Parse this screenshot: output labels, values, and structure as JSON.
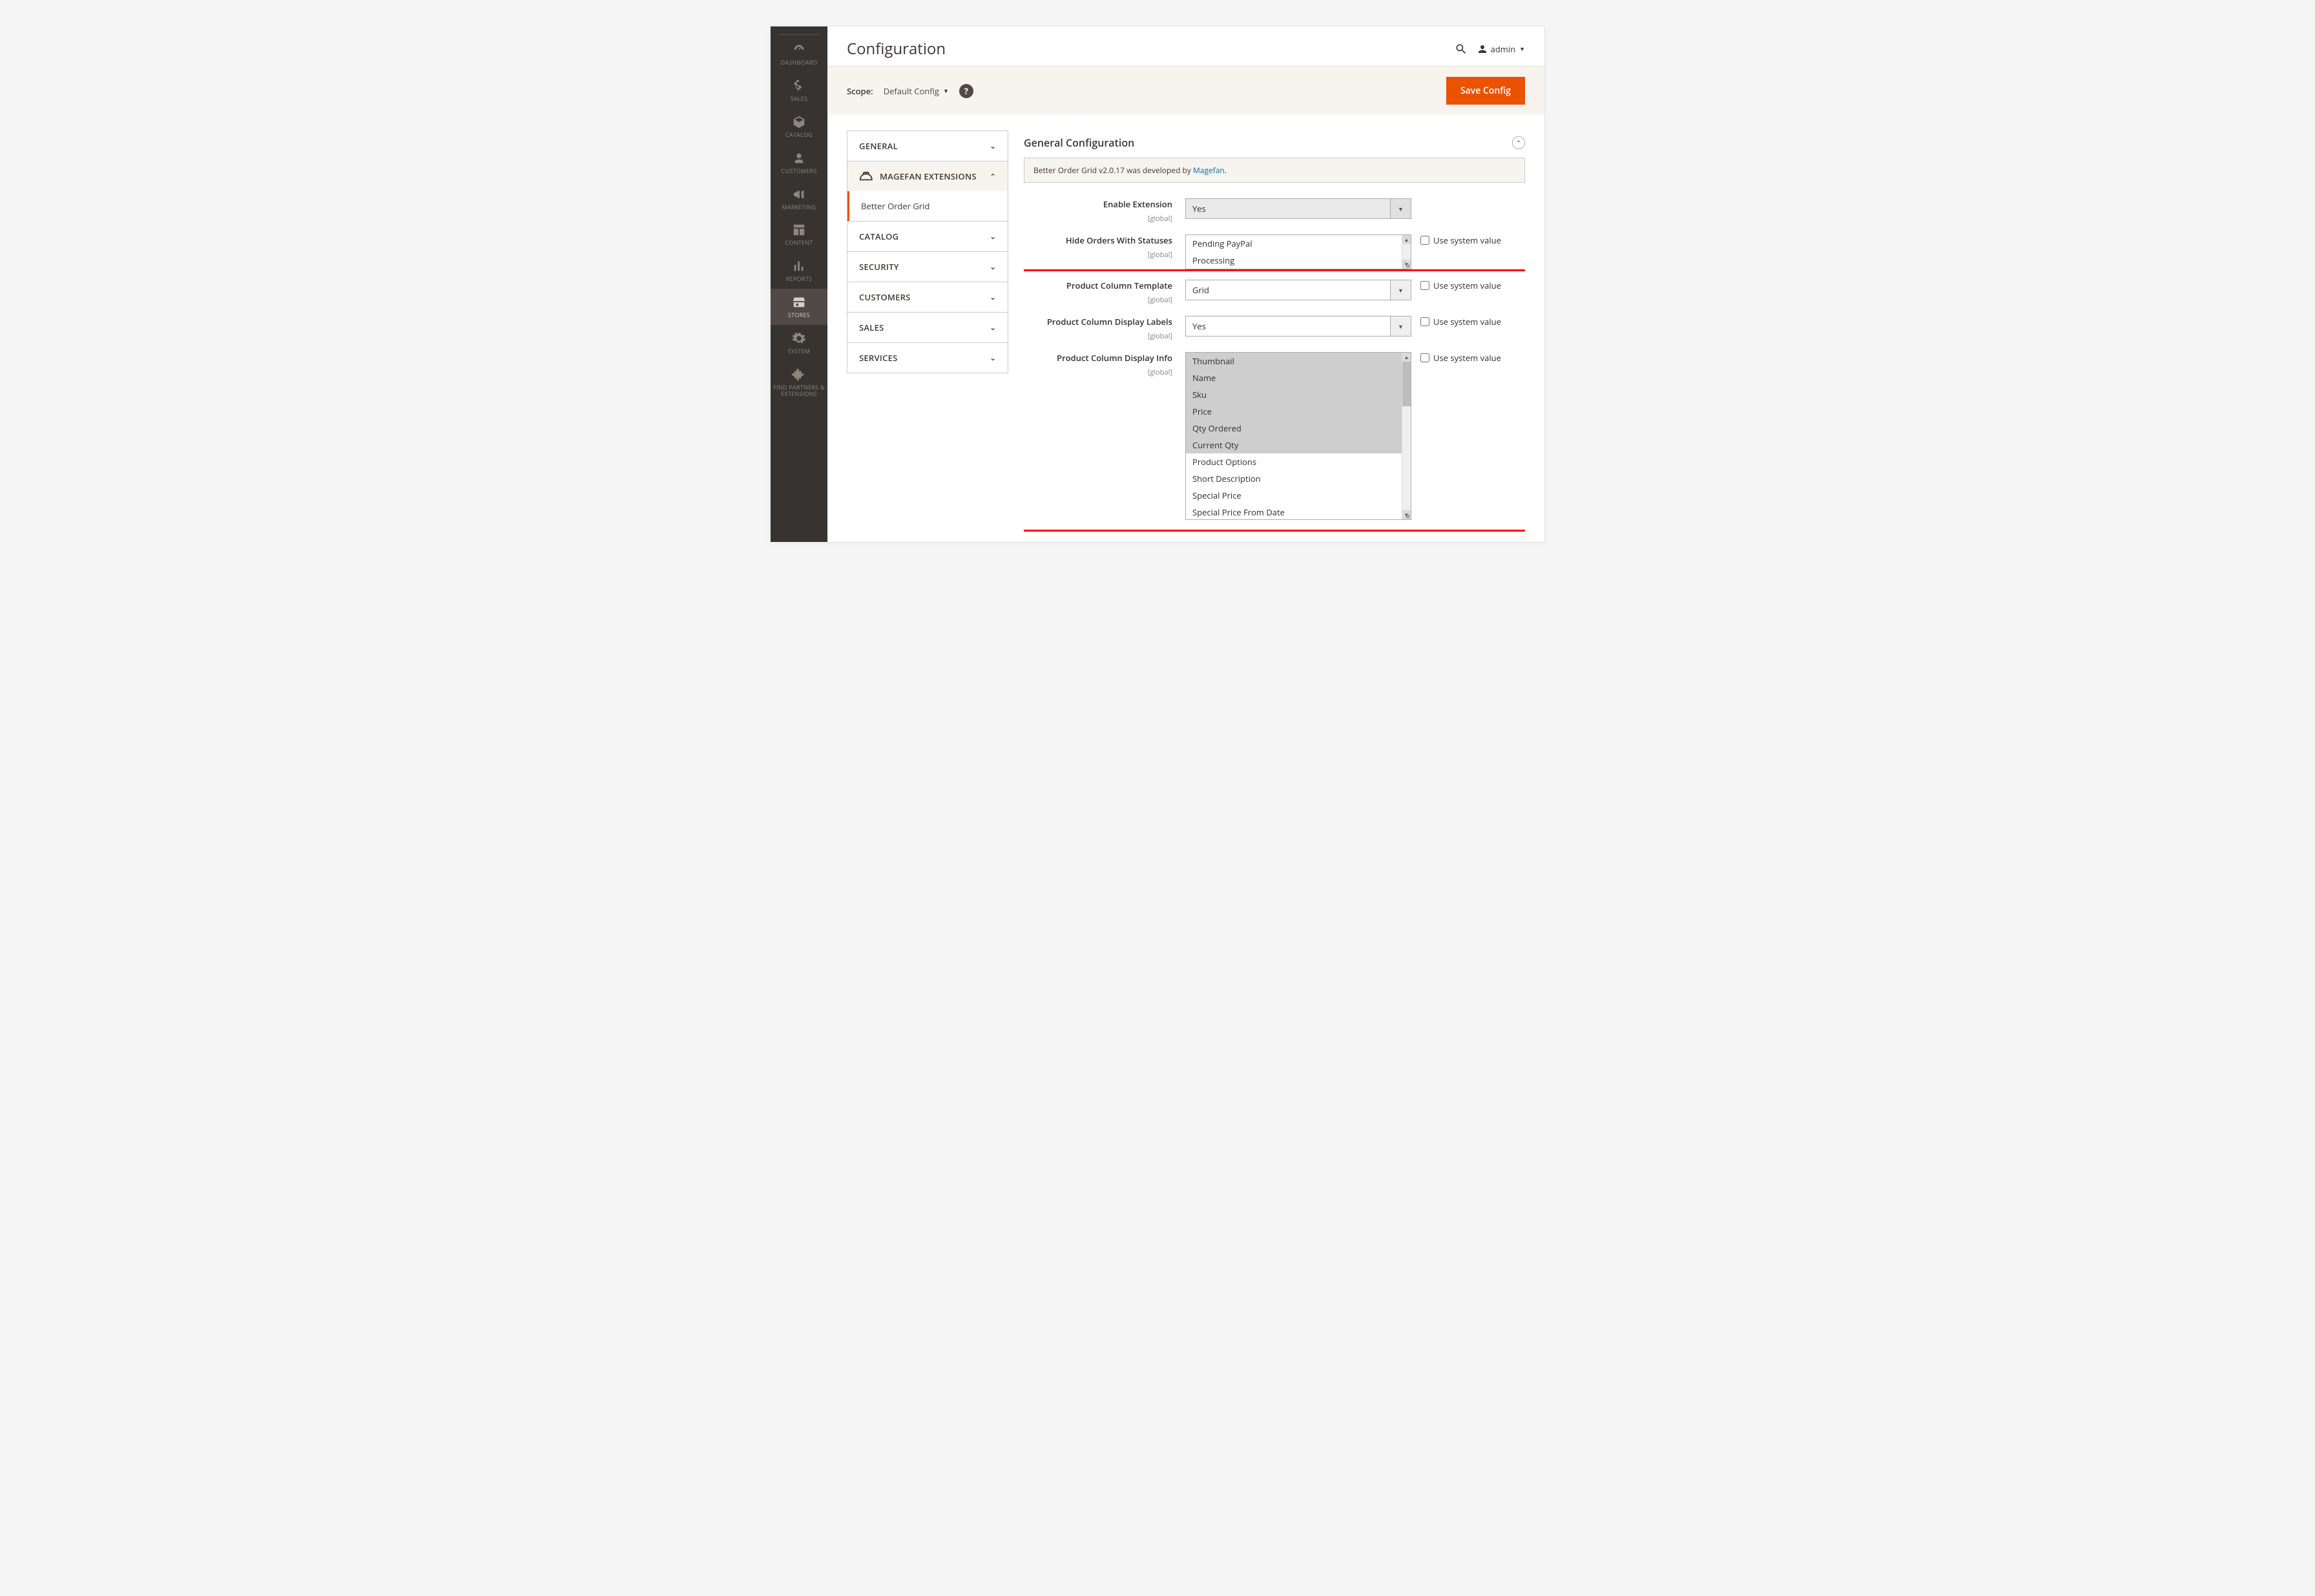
{
  "sidebar": {
    "items": [
      {
        "label": "DASHBOARD",
        "name": "sidebar-dashboard",
        "icon": "dash"
      },
      {
        "label": "SALES",
        "name": "sidebar-sales",
        "icon": "dollar"
      },
      {
        "label": "CATALOG",
        "name": "sidebar-catalog",
        "icon": "box"
      },
      {
        "label": "CUSTOMERS",
        "name": "sidebar-customers",
        "icon": "person"
      },
      {
        "label": "MARKETING",
        "name": "sidebar-marketing",
        "icon": "megaphone"
      },
      {
        "label": "CONTENT",
        "name": "sidebar-content",
        "icon": "layout"
      },
      {
        "label": "REPORTS",
        "name": "sidebar-reports",
        "icon": "bars"
      },
      {
        "label": "STORES",
        "name": "sidebar-stores",
        "icon": "store",
        "active": true
      },
      {
        "label": "SYSTEM",
        "name": "sidebar-system",
        "icon": "gear"
      },
      {
        "label": "FIND PARTNERS & EXTENSIONS",
        "name": "sidebar-partners",
        "icon": "puzzle"
      }
    ]
  },
  "header": {
    "title": "Configuration",
    "user": "admin"
  },
  "toolbar": {
    "scope_label": "Scope:",
    "scope_value": "Default Config",
    "save": "Save Config"
  },
  "configNav": {
    "groups": [
      {
        "label": "GENERAL",
        "open": false
      },
      {
        "label": "MAGEFAN EXTENSIONS",
        "open": true,
        "logo": true,
        "sub": [
          {
            "label": "Better Order Grid",
            "active": true
          }
        ]
      },
      {
        "label": "CATALOG"
      },
      {
        "label": "SECURITY"
      },
      {
        "label": "CUSTOMERS"
      },
      {
        "label": "SALES"
      },
      {
        "label": "SERVICES"
      }
    ]
  },
  "panel": {
    "title": "General Configuration",
    "note_prefix": "Better Order Grid v2.0.17 was developed by ",
    "note_link": "Magefan",
    "note_suffix": ".",
    "scope_tag": "[global]",
    "sys_label": "Use system value",
    "fields": {
      "enable": {
        "label": "Enable Extension",
        "value": "Yes"
      },
      "hide": {
        "label": "Hide Orders With Statuses",
        "options": [
          "Pending PayPal",
          "Processing"
        ]
      },
      "template": {
        "label": "Product Column Template",
        "value": "Grid"
      },
      "display_labels": {
        "label": "Product Column Display Labels",
        "value": "Yes"
      },
      "display_info": {
        "label": "Product Column Display Info",
        "options": [
          {
            "v": "Thumbnail",
            "sel": true
          },
          {
            "v": "Name",
            "sel": true
          },
          {
            "v": "Sku",
            "sel": true
          },
          {
            "v": "Price",
            "sel": true
          },
          {
            "v": "Qty Ordered",
            "sel": true
          },
          {
            "v": "Current Qty",
            "sel": true
          },
          {
            "v": "Product Options"
          },
          {
            "v": "Short Description"
          },
          {
            "v": "Special Price"
          },
          {
            "v": "Special Price From Date"
          }
        ]
      }
    }
  }
}
